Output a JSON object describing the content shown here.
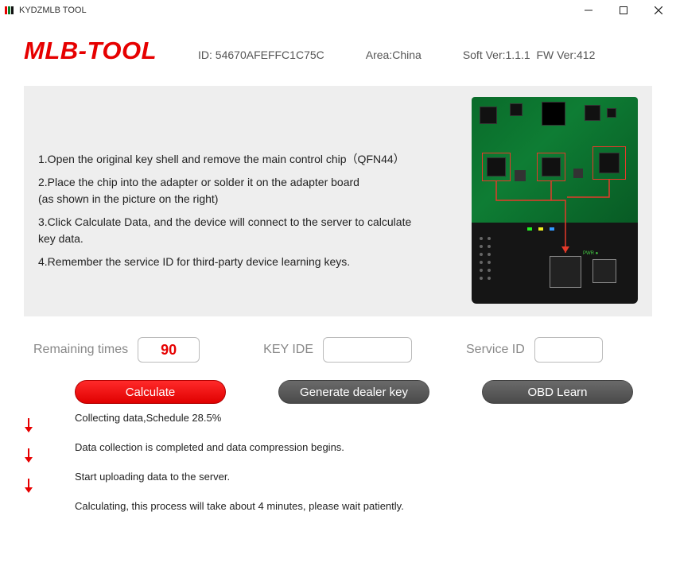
{
  "window": {
    "title": "KYDZMLB TOOL"
  },
  "header": {
    "logo": "MLB-TOOL",
    "id_label": "ID:",
    "id_value": "54670AFEFFC1C75C",
    "area_label": "Area:",
    "area_value": "China",
    "soft_label": "Soft Ver:",
    "soft_value": "1.1.1",
    "fw_label": "FW Ver:",
    "fw_value": "412"
  },
  "instructions": {
    "step1": "1.Open the original key shell and remove the main control chip（QFN44）",
    "step2a": "2.Place the chip into the adapter or solder it on the adapter board",
    "step2b": "(as shown in the picture on the right)",
    "step3a": "3.Click Calculate Data, and the device will connect to the server to calculate",
    "step3b": "key data.",
    "step4": "4.Remember the service ID for third-party device learning keys."
  },
  "fields": {
    "remaining_label": "Remaining times",
    "remaining_value": "90",
    "keyide_label": "KEY IDE",
    "keyide_value": "",
    "serviceid_label": "Service ID",
    "serviceid_value": ""
  },
  "buttons": {
    "calculate": "Calculate",
    "generate": "Generate dealer key",
    "obd": "OBD Learn"
  },
  "status": {
    "line1": "Collecting data,Schedule 28.5%",
    "line2": "Data collection is completed and data compression begins.",
    "line3": "Start uploading data to the server.",
    "line4": "Calculating, this process will take about 4 minutes, please wait patiently."
  }
}
